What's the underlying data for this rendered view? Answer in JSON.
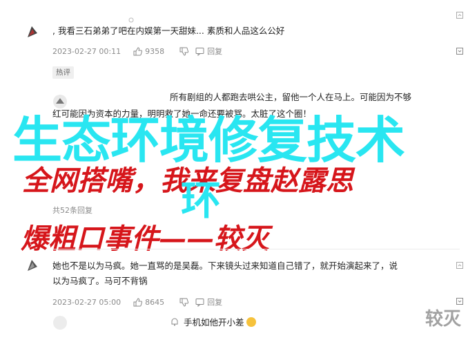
{
  "comments": [
    {
      "text": ", 我看三石弟弟了吧在内娱第一天甜妹... 素质和人品这么公好",
      "date": "2023-02-27 00:11",
      "likes": "9358",
      "reply": "回复"
    },
    {
      "text_line1": "所有剧组的人都跑去哄公主，留他一个人在马上。可能因为不够",
      "text_line2": "红可能因为资本的力量，明明救了她一命还要被骂。太脏了这个圈！"
    },
    {
      "text_line1": "她也不是以为马疯。她一直骂的是吴磊。下来镜头过来知道自己错了，就开始演起来了，说",
      "text_line2": "以为马疯了。马可不背锅",
      "date": "2023-02-27 05:00",
      "likes": "8645",
      "reply": "回复"
    },
    {
      "text": "手机如他开小差"
    }
  ],
  "hot_badge": "热评",
  "replies_summary": "共52条回复",
  "overlay": {
    "title": "生态环境修复技术",
    "red_line1": "全网搭嘴，我来复盘赵露思",
    "cyan_small": "环",
    "red_line2": "爆粗口事件——较灭"
  },
  "watermark": "较灭",
  "colors": {
    "overlay_cyan": "#29e6f1",
    "overlay_red": "#d6161b"
  }
}
